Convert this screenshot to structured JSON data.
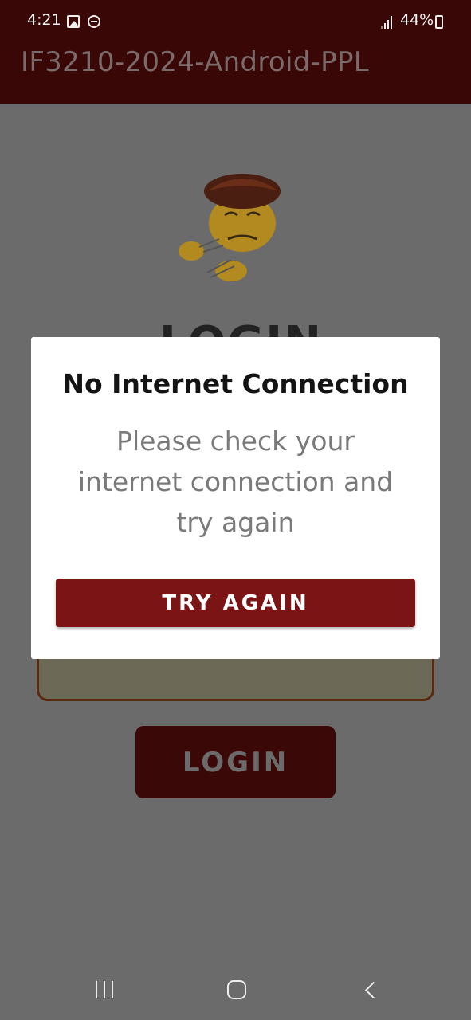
{
  "status_bar": {
    "time": "4:21",
    "battery": "44%",
    "icons": [
      "image-icon",
      "do-not-disturb-icon",
      "signal-icon",
      "battery-icon"
    ]
  },
  "app_bar": {
    "title": "IF3210-2024-Android-PPL"
  },
  "login_screen": {
    "heading": "LOGIN",
    "password_mask": "••••••••••••••••••••",
    "login_button": "LOGIN"
  },
  "dialog": {
    "title": "No Internet Connection",
    "message_line1": "Please check your",
    "message_line2": "internet connection and",
    "message_line3": "try again",
    "button": "TRY AGAIN"
  },
  "nav_bar": {
    "icons": [
      "recents-icon",
      "home-icon",
      "back-icon"
    ]
  },
  "colors": {
    "primary_dark": "#3a0707",
    "button_red": "#7b1515",
    "scrim": "#6b6b6b"
  }
}
